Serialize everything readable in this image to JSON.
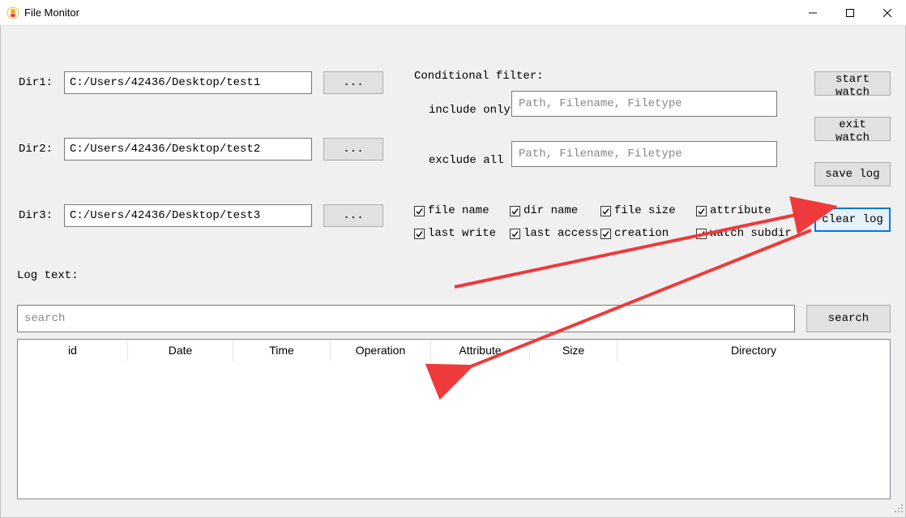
{
  "window": {
    "title": "File Monitor"
  },
  "dirs": {
    "label1": "Dir1:",
    "label2": "Dir2:",
    "label3": "Dir3:",
    "path1": "C:/Users/42436/Desktop/test1",
    "path2": "C:/Users/42436/Desktop/test2",
    "path3": "C:/Users/42436/Desktop/test3",
    "browse": "..."
  },
  "filters": {
    "header": "Conditional filter:",
    "include_label": "include only",
    "exclude_label": "exclude  all",
    "include_placeholder": "Path, Filename, Filetype",
    "exclude_placeholder": "Path, Filename, Filetype"
  },
  "checkboxes": {
    "file_name": "file name",
    "dir_name": "dir name",
    "file_size": "file size",
    "attribute": "attribute",
    "last_write": "last write",
    "last_access": "last access",
    "creation": "creation",
    "watch_subdir": "watch subdir"
  },
  "actions": {
    "start_watch": "start watch",
    "exit_watch": "exit watch",
    "save_log": "save log",
    "clear_log": "clear log"
  },
  "log": {
    "label": "Log text:",
    "search_placeholder": "search",
    "search_btn": "search"
  },
  "columns": {
    "id": "id",
    "date": "Date",
    "time": "Time",
    "operation": "Operation",
    "attribute": "Attribute",
    "size": "Size",
    "directory": "Directory"
  }
}
